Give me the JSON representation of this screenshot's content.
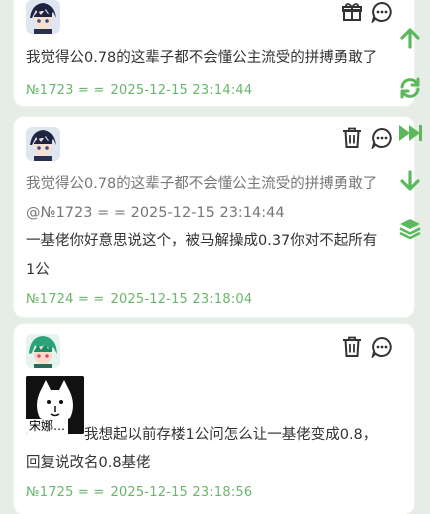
{
  "posts": [
    {
      "body": "我觉得公0.78的这辈子都不会懂公主流受的拼搏勇敢了",
      "meta_id": "№1723 = =",
      "meta_time": "2025-12-15 23:14:44",
      "actions": [
        "gift-icon",
        "comment-icon"
      ]
    },
    {
      "quote_line1": "我觉得公0.78的这辈子都不会懂公主流受的拼搏勇敢了",
      "quote_line2": "@№1723 = = 2025-12-15 23:14:44",
      "body_line1": "一基佬你好意思说这个，被马解操成0.37你对不起所有",
      "body_line2": "1公",
      "meta_id": "№1724 = =",
      "meta_time": "2025-12-15 23:18:04",
      "actions": [
        "trash-icon",
        "comment-icon"
      ]
    },
    {
      "sticker_caption": "宋娜…",
      "body_line1": "我想起以前存楼1公问怎么让一基佬变成0.8，",
      "body_line2": "回复说改名0.8基佬",
      "meta_id": "№1725 = =",
      "meta_time": "2025-12-15 23:18:56",
      "actions": [
        "trash-icon",
        "comment-icon"
      ]
    }
  ],
  "side_actions": [
    "arrow-up-icon",
    "refresh-icon",
    "fast-forward-icon",
    "arrow-down-icon",
    "layers-icon"
  ],
  "colors": {
    "accent": "#5cb85c",
    "meta_text": "#6ab66c",
    "background": "#e6ece6"
  }
}
